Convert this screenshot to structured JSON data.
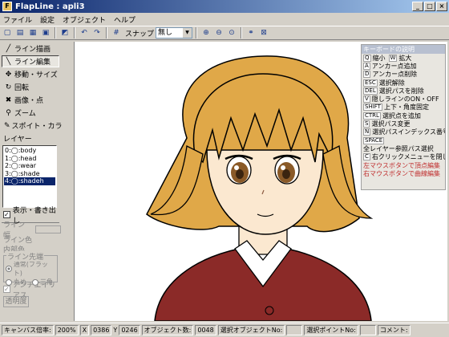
{
  "window": {
    "title": "FlapLine : apli3"
  },
  "menu": [
    "ファイル",
    "設定",
    "オブジェクト",
    "ヘルプ"
  ],
  "toolbar": {
    "snap_label": "スナップ",
    "snap_value": "無し"
  },
  "tools": [
    {
      "label": "ライン描画",
      "icon": "pen-icon",
      "active": false
    },
    {
      "label": "ライン編集",
      "icon": "line-edit-icon",
      "active": true
    },
    {
      "label": "移動・サイズ",
      "icon": "move-icon",
      "active": false
    },
    {
      "label": "回転",
      "icon": "rotate-icon",
      "active": false
    },
    {
      "label": "画像・点",
      "icon": "image-point-icon",
      "active": false
    },
    {
      "label": "ズーム",
      "icon": "zoom-icon",
      "active": false
    },
    {
      "label": "スポイト・カラー",
      "icon": "eyedropper-icon",
      "active": false
    }
  ],
  "layers": {
    "label": "レイヤー",
    "items": [
      "0:◯:body",
      "1:◯:head",
      "2:◯:wear",
      "3:◯:shade",
      "4:◯:shadeh"
    ],
    "selected_index": 4
  },
  "show_write_label": "表示・書き出し",
  "props": {
    "line_width": "ライン幅",
    "line_color": "ライン色",
    "fill_color": "内部色",
    "line_end": {
      "legend": "ライン先端",
      "opt1": "通常(フラット)",
      "opt2": "丸め",
      "opt3": "三角"
    },
    "antialias": "アンチエイリアス",
    "opacity": "透明度"
  },
  "keyboard_help": {
    "title": "キーボードの説明",
    "rows": [
      {
        "keys": [
          "Q"
        ],
        "text": "縮小",
        "keys2": [
          "W"
        ],
        "text2": "拡大"
      },
      {
        "keys": [
          "A"
        ],
        "text": "アンカー点追加"
      },
      {
        "keys": [
          "D"
        ],
        "text": "アンカー点削除"
      },
      {
        "keys": [
          "ESC"
        ],
        "text": "選択解除"
      },
      {
        "keys": [
          "DEL"
        ],
        "text": "選択パスを削除"
      },
      {
        "keys": [
          "V"
        ],
        "text": "隠しラインのON・OFF"
      },
      {
        "keys": [
          "SHIFT"
        ],
        "text": "上下・角度固定"
      },
      {
        "keys": [
          "CTRL"
        ],
        "text": "選択点を追加"
      },
      {
        "keys": [
          "S"
        ],
        "text": "選択パス変更"
      },
      {
        "keys": [
          "N"
        ],
        "text": "選択パスインデックス番号"
      },
      {
        "keys": [
          "SPACE"
        ],
        "text": ""
      },
      {
        "keys": [],
        "text": "全レイヤー参照パス選択"
      },
      {
        "keys": [
          "C"
        ],
        "text": "右クリックメニューを閉じる"
      }
    ],
    "red_rows": [
      "左マウスボタンで頂点編集",
      "右マウスボタンで曲線編集"
    ]
  },
  "status": {
    "zoom_label": "キャンバス倍率:",
    "zoom_value": "200%",
    "x_label": "X",
    "x_value": "0386",
    "y_label": "Y",
    "y_value": "0246",
    "objects_label": "オブジェクト数:",
    "objects_value": "0048",
    "sel_object_label": "選択オブジェクトNo:",
    "sel_object_value": "",
    "sel_point_label": "選択ポイントNo:",
    "sel_point_value": "",
    "comment_label": "コメント:",
    "comment_value": ""
  },
  "colors": {
    "hair": "#e0a848",
    "hair_dark": "#c88830",
    "skin": "#fbe8d0",
    "eye": "#8a5a28",
    "shirt": "#8b2a28",
    "collar": "#ffffff",
    "titlebar": "#0a246a"
  }
}
